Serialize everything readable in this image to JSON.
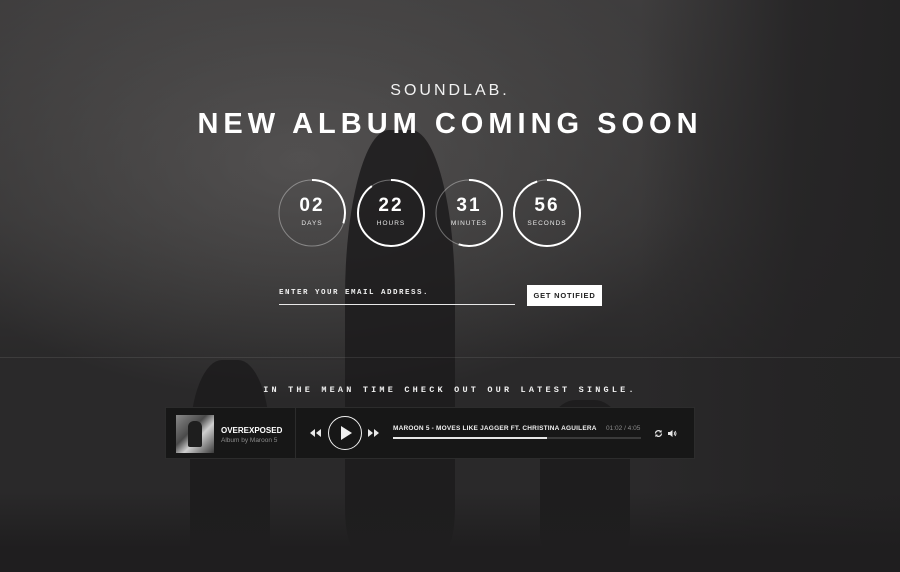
{
  "header": {
    "brand": "SOUNDLAB.",
    "headline": "NEW ALBUM COMING SOON"
  },
  "countdown": [
    {
      "value": "02",
      "label": "DAYS",
      "progress": 0.3
    },
    {
      "value": "22",
      "label": "HOURS",
      "progress": 0.9
    },
    {
      "value": "31",
      "label": "MINUTES",
      "progress": 0.55
    },
    {
      "value": "56",
      "label": "SECONDS",
      "progress": 0.95
    }
  ],
  "signup": {
    "placeholder": "ENTER YOUR EMAIL ADDRESS.",
    "button_label": "GET NOTIFIED"
  },
  "meantime_text": "IN THE MEAN TIME CHECK OUT OUR LATEST SINGLE.",
  "player": {
    "album_title": "OVEREXPOSED",
    "album_subtitle": "Album by Maroon 5",
    "track": "MAROON 5 - MOVES LIKE JAGGER FT. CHRISTINA AGUILERA",
    "time": "01:02 / 4:05",
    "progress": 0.62,
    "icons": [
      "rewind-icon",
      "play-icon",
      "fast-forward-icon",
      "repeat-icon",
      "volume-icon"
    ]
  },
  "colors": {
    "background": "#242324",
    "accent": "#ffffff",
    "player_bg": "#171717"
  }
}
